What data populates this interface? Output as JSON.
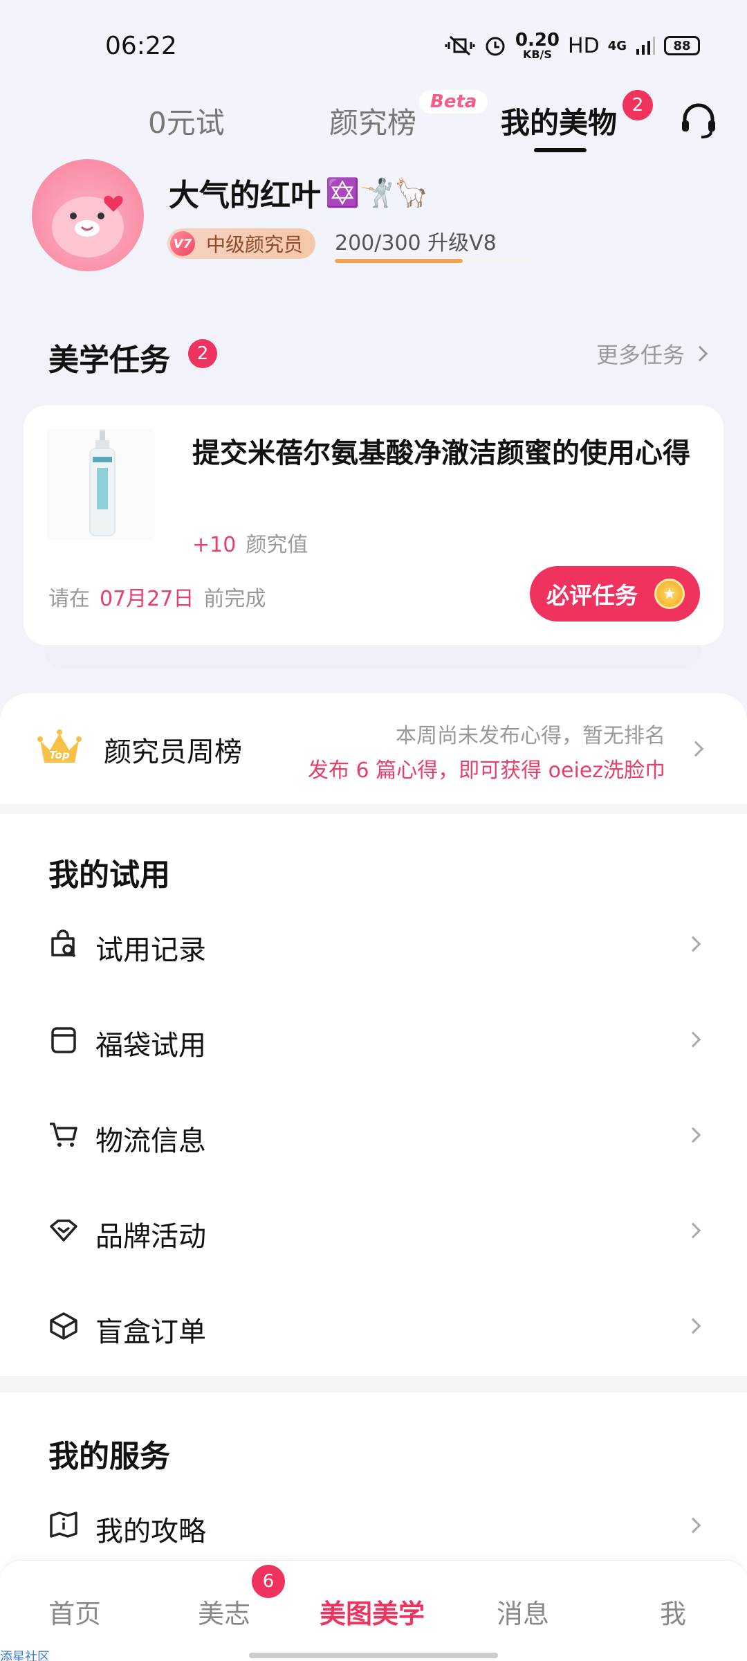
{
  "status_bar": {
    "time": "06:22",
    "net_speed_value": "0.20",
    "net_speed_unit": "KB/S",
    "hd": "HD",
    "network": "4G",
    "battery": "88"
  },
  "top_tabs": [
    {
      "label": "0元试"
    },
    {
      "label": "颜究榜"
    },
    {
      "label": "我的美物"
    }
  ],
  "beta_label": "Beta",
  "my_items_badge": "2",
  "profile": {
    "nickname": "大气的红叶",
    "nickname_emoji": "✡️🤺🦙",
    "level_badge": "V7",
    "level_title": "中级颜究员",
    "progress_text": "200/300  升级V8",
    "progress_ratio": 0.667
  },
  "tasks_section": {
    "title": "美学任务",
    "badge": "2",
    "more_label": "更多任务"
  },
  "task_card": {
    "title": "提交米蓓尔氨基酸净澈洁颜蜜的使用心得",
    "reward_points": "+10",
    "reward_unit": "颜究值",
    "deadline_prefix": "请在",
    "deadline_date": "07月27日",
    "deadline_suffix": "前完成",
    "button_label": "必评任务"
  },
  "weekly_rank": {
    "title": "颜究员周榜",
    "crown_text": "Top",
    "line1": "本周尚未发布心得，暂无排名",
    "line2": "发布 6 篇心得，即可获得 oeiez洗脸巾"
  },
  "trial_section": {
    "title": "我的试用",
    "items": [
      {
        "label": "试用记录",
        "icon": "search-bag-icon"
      },
      {
        "label": "福袋试用",
        "icon": "lucky-bag-icon"
      },
      {
        "label": "物流信息",
        "icon": "cart-icon"
      },
      {
        "label": "品牌活动",
        "icon": "diamond-icon"
      },
      {
        "label": "盲盒订单",
        "icon": "box-icon"
      }
    ]
  },
  "service_section": {
    "title": "我的服务",
    "items": [
      {
        "label": "我的攻略",
        "icon": "guide-book-icon"
      }
    ]
  },
  "bottom_nav": {
    "items": [
      {
        "label": "首页"
      },
      {
        "label": "美志",
        "badge": "6"
      },
      {
        "label": "美图美学"
      },
      {
        "label": "消息"
      },
      {
        "label": "我"
      }
    ]
  },
  "watermark": "添星社区",
  "colors": {
    "accent": "#f0335e",
    "progress": "#f0a451",
    "reward_text": "#e4406b"
  }
}
